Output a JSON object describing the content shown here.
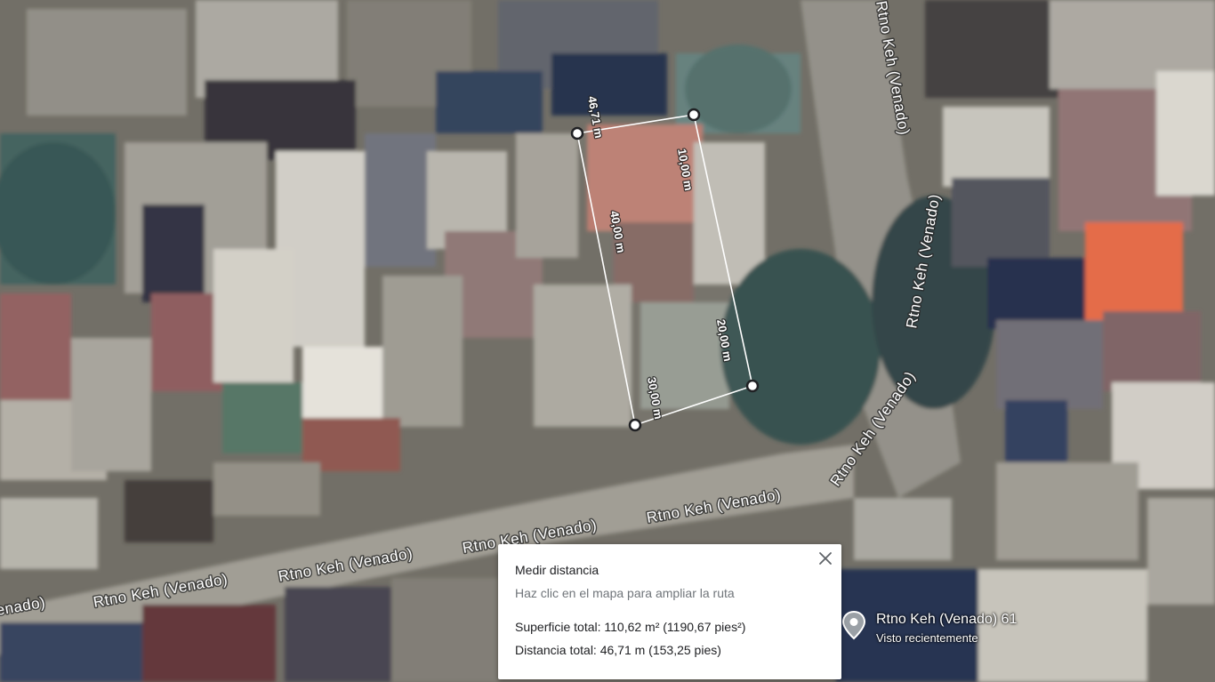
{
  "map": {
    "street_name": "Rtno Keh (Venado)",
    "street_name_edge": "Venado)",
    "segments": {
      "top": "46,71 m",
      "right_upper": "10,00 m",
      "left": "40,00 m",
      "right_lower": "20,00 m",
      "bottom": "30,00 m"
    }
  },
  "measure_panel": {
    "title": "Medir distancia",
    "hint": "Haz clic en el mapa para ampliar la ruta",
    "area": "Superficie total: 110,62 m² (1190,67 pies²)",
    "distance": "Distancia total: 46,71 m (153,25 pies)",
    "close_icon": "close-icon"
  },
  "place": {
    "name": "Rtno Keh (Venado) 61",
    "subtitle": "Visto recientemente",
    "icon": "location-pin-icon"
  },
  "colors": {
    "measure_line": "#ffffff",
    "pin": "#9aa0a6",
    "panel_bg": "#ffffff"
  }
}
